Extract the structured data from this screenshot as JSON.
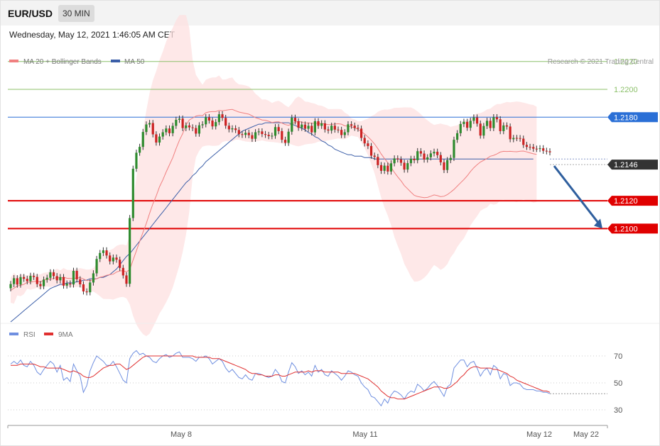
{
  "header": {
    "symbol": "EUR/USD",
    "timeframe": "30 MIN",
    "datetime": "Wednesday, May 12, 2021 1:46:05 AM CET"
  },
  "legend": {
    "ma20": "MA 20 + Bollinger Bands",
    "ma50": "MA 50",
    "copyright": "Research © 2021 Trading Central"
  },
  "rsi_legend": {
    "rsi": "RSI",
    "ma": "9MA"
  },
  "colors": {
    "up": "#2e8b2e",
    "down": "#cc2222",
    "ma20": "#f08080",
    "ma50": "#3b5ea8",
    "band": "#fde0e0",
    "resistance": "#2a6fd6",
    "support": "#e00000",
    "target_arrow": "#2f5f9e",
    "rsi": "#6f8fe0",
    "rsi_ma": "#e03030",
    "green_level": "#8cc06a"
  },
  "chart_data": [
    {
      "type": "line",
      "title": "",
      "x_ticks": [
        "May 8",
        "May 11",
        "May 12",
        "May 22"
      ],
      "y_ticks": [
        "1.2220",
        "1.2200",
        "1.2180",
        "1.2146",
        "1.2120",
        "1.2100"
      ],
      "ylim": [
        1.2032,
        1.2228
      ],
      "levels": [
        {
          "value": 1.222,
          "label": "1.2220",
          "kind": "green"
        },
        {
          "value": 1.22,
          "label": "1.2200",
          "kind": "green"
        },
        {
          "value": 1.218,
          "label": "1.2180",
          "kind": "resistance"
        },
        {
          "value": 1.2146,
          "label": "1.2146",
          "kind": "last"
        },
        {
          "value": 1.212,
          "label": "1.2120",
          "kind": "support"
        },
        {
          "value": 1.21,
          "label": "1.2100",
          "kind": "support"
        }
      ],
      "close": [
        1.20602,
        1.20644,
        1.20598,
        1.20652,
        1.2064,
        1.20622,
        1.20661,
        1.20653,
        1.20602,
        1.20587,
        1.20634,
        1.20647,
        1.20686,
        1.20659,
        1.20629,
        1.20652,
        1.20591,
        1.20606,
        1.20599,
        1.20697,
        1.20636,
        1.206,
        1.20549,
        1.20543,
        1.20613,
        1.20679,
        1.20782,
        1.20825,
        1.20844,
        1.20807,
        1.20765,
        1.20792,
        1.20777,
        1.20718,
        1.20664,
        1.20604,
        1.21076,
        1.2143,
        1.21545,
        1.21587,
        1.21694,
        1.21748,
        1.21758,
        1.21677,
        1.21618,
        1.21661,
        1.21692,
        1.21719,
        1.21685,
        1.21738,
        1.21781,
        1.2179,
        1.21722,
        1.21741,
        1.21727,
        1.21722,
        1.21682,
        1.21742,
        1.21749,
        1.218,
        1.21776,
        1.21734,
        1.21765,
        1.21821,
        1.21795,
        1.21739,
        1.21713,
        1.2172,
        1.21708,
        1.21678,
        1.21673,
        1.21688,
        1.21671,
        1.21645,
        1.21692,
        1.21698,
        1.21679,
        1.21673,
        1.21664,
        1.21667,
        1.21729,
        1.217,
        1.21638,
        1.21616,
        1.21696,
        1.21796,
        1.2177,
        1.21724,
        1.21747,
        1.21717,
        1.21738,
        1.21691,
        1.21771,
        1.21738,
        1.21756,
        1.21712,
        1.21704,
        1.21739,
        1.21711,
        1.21709,
        1.21672,
        1.21692,
        1.21749,
        1.21739,
        1.21724,
        1.21718,
        1.21651,
        1.21612,
        1.21593,
        1.21524,
        1.21515,
        1.21456,
        1.21415,
        1.21452,
        1.2141,
        1.21469,
        1.21504,
        1.21497,
        1.21473,
        1.21424,
        1.2147,
        1.21501,
        1.21491,
        1.21556,
        1.21539,
        1.21496,
        1.21512,
        1.2154,
        1.21552,
        1.21528,
        1.21476,
        1.21421,
        1.21492,
        1.21508,
        1.21638,
        1.21685,
        1.21751,
        1.21767,
        1.21724,
        1.21774,
        1.21798,
        1.21754,
        1.21668,
        1.21737,
        1.21774,
        1.21722,
        1.218,
        1.21785,
        1.217,
        1.21741,
        1.21733,
        1.21642,
        1.21651,
        1.2165,
        1.21646,
        1.21601,
        1.21587,
        1.21586,
        1.21574,
        1.21572,
        1.21577,
        1.21559,
        1.21555,
        1.21548
      ],
      "ma20": [
        1.20557,
        1.20572,
        1.20588,
        1.20593,
        1.206,
        1.20615,
        1.20616,
        1.2062,
        1.20624,
        1.20616,
        1.20632,
        1.20635,
        1.20638,
        1.20642,
        1.2065,
        1.20645,
        1.20651,
        1.20644,
        1.20642,
        1.20642,
        1.20646,
        1.20648,
        1.20639,
        1.20627,
        1.20628,
        1.20632,
        1.20641,
        1.20651,
        1.20656,
        1.20665,
        1.2067,
        1.20673,
        1.20688,
        1.20696,
        1.20698,
        1.20689,
        1.20706,
        1.20774,
        1.2084,
        1.20908,
        1.20974,
        1.21037,
        1.2111,
        1.21178,
        1.21235,
        1.213,
        1.2135,
        1.21407,
        1.21458,
        1.2151,
        1.21574,
        1.21634,
        1.21682,
        1.21744,
        1.2178,
        1.21794,
        1.21808,
        1.21813,
        1.21811,
        1.21832,
        1.21838,
        1.2184,
        1.2184,
        1.21849,
        1.21846,
        1.2185,
        1.21854,
        1.21856,
        1.21846,
        1.21837,
        1.21832,
        1.21827,
        1.21822,
        1.2181,
        1.21797,
        1.21789,
        1.2178,
        1.21778,
        1.21771,
        1.21762,
        1.21766,
        1.21767,
        1.21758,
        1.21747,
        1.21742,
        1.21751,
        1.21764,
        1.2177,
        1.21765,
        1.21758,
        1.21759,
        1.21756,
        1.21756,
        1.21755,
        1.21755,
        1.21751,
        1.21746,
        1.21748,
        1.21751,
        1.21753,
        1.2175,
        1.21738,
        1.21736,
        1.2173,
        1.21723,
        1.21714,
        1.21695,
        1.2168,
        1.21659,
        1.21635,
        1.21608,
        1.21574,
        1.21536,
        1.21503,
        1.21474,
        1.21441,
        1.21404,
        1.21372,
        1.21343,
        1.21309,
        1.21286,
        1.21262,
        1.21239,
        1.21231,
        1.21226,
        1.21222,
        1.21224,
        1.21233,
        1.21242,
        1.21237,
        1.21229,
        1.21233,
        1.21244,
        1.21262,
        1.21281,
        1.21305,
        1.21329,
        1.21352,
        1.21379,
        1.2141,
        1.21437,
        1.21459,
        1.21478,
        1.21491,
        1.21504,
        1.2152,
        1.21526,
        1.21536,
        1.2155,
        1.21555,
        1.21554,
        1.21555,
        1.21553,
        1.21552,
        1.21556,
        1.21557,
        1.21551,
        1.21544,
        1.21537,
        1.21533
      ],
      "ma50": [
        1.2033,
        1.2035,
        1.2037,
        1.2039,
        1.2041,
        1.2043,
        1.2045,
        1.2047,
        1.2049,
        1.2051,
        1.2053,
        1.2055,
        1.2057,
        1.2058,
        1.2059,
        1.206,
        1.206,
        1.2061,
        1.2061,
        1.2061,
        1.2062,
        1.2062,
        1.2063,
        1.2063,
        1.2064,
        1.2064,
        1.2064,
        1.2065,
        1.2065,
        1.2066,
        1.2067,
        1.2069,
        1.2071,
        1.2074,
        1.2077,
        1.208,
        1.2082,
        1.2085,
        1.2088,
        1.2091,
        1.2094,
        1.2097,
        1.21,
        1.2103,
        1.2106,
        1.2109,
        1.2112,
        1.2115,
        1.2118,
        1.2121,
        1.2124,
        1.2127,
        1.213,
        1.2133,
        1.2135,
        1.2138,
        1.214,
        1.2143,
        1.2145,
        1.2148,
        1.215,
        1.2152,
        1.2154,
        1.2156,
        1.2158,
        1.216,
        1.2162,
        1.2164,
        1.2166,
        1.2168,
        1.217,
        1.2171,
        1.2172,
        1.2173,
        1.2174,
        1.2175,
        1.2175,
        1.2176,
        1.2176,
        1.2176,
        1.2176,
        1.2176,
        1.2176,
        1.2176,
        1.2176,
        1.2175,
        1.2174,
        1.2173,
        1.2172,
        1.2171,
        1.2169,
        1.2168,
        1.2166,
        1.2165,
        1.2163,
        1.2162,
        1.216,
        1.2159,
        1.2157,
        1.2156,
        1.2155,
        1.2154,
        1.2153,
        1.2153,
        1.2152,
        1.2152,
        1.2152,
        1.2151,
        1.2151,
        1.2151,
        1.215,
        1.215,
        1.215,
        1.215,
        1.215,
        1.215,
        1.215,
        1.215,
        1.215,
        1.215,
        1.215,
        1.215,
        1.215,
        1.215,
        1.215,
        1.215,
        1.215,
        1.215,
        1.215,
        1.215,
        1.215,
        1.215,
        1.215,
        1.215,
        1.215,
        1.215,
        1.215,
        1.215,
        1.215,
        1.215,
        1.215,
        1.215,
        1.215,
        1.215,
        1.215,
        1.215,
        1.215,
        1.215,
        1.215,
        1.215,
        1.215,
        1.215,
        1.215,
        1.215,
        1.215,
        1.215,
        1.215,
        1.215,
        1.215
      ],
      "target": {
        "from": 1.2146,
        "to": 1.21
      }
    },
    {
      "type": "line",
      "title": "",
      "y_ticks": [
        "70",
        "50",
        "30"
      ],
      "ylim": [
        20,
        80
      ],
      "rsi": [
        64,
        66,
        64,
        67,
        63,
        62,
        66,
        63,
        58,
        56,
        60,
        63,
        66,
        64,
        58,
        63,
        52,
        54,
        51,
        64,
        59,
        55,
        43,
        48,
        59,
        65,
        70,
        68,
        66,
        63,
        63,
        66,
        62,
        57,
        52,
        50,
        68,
        72,
        74,
        71,
        72,
        70,
        69,
        66,
        65,
        68,
        70,
        71,
        69,
        70,
        72,
        73,
        69,
        69,
        69,
        68,
        66,
        69,
        69,
        70,
        68,
        64,
        66,
        68,
        66,
        61,
        58,
        60,
        57,
        54,
        53,
        56,
        53,
        52,
        57,
        57,
        56,
        55,
        54,
        55,
        60,
        57,
        51,
        50,
        58,
        65,
        62,
        57,
        59,
        56,
        58,
        55,
        63,
        58,
        60,
        56,
        55,
        59,
        57,
        55,
        52,
        55,
        59,
        58,
        56,
        55,
        50,
        47,
        45,
        40,
        39,
        36,
        33,
        38,
        35,
        41,
        44,
        43,
        41,
        38,
        42,
        44,
        43,
        49,
        47,
        44,
        46,
        49,
        51,
        48,
        44,
        40,
        47,
        49,
        61,
        64,
        67,
        67,
        62,
        65,
        66,
        61,
        55,
        59,
        61,
        56,
        63,
        61,
        53,
        57,
        56,
        48,
        50,
        50,
        49,
        46,
        45,
        45,
        45,
        44,
        44,
        43,
        43,
        42
      ],
      "rsi_ma": [
        63,
        63,
        63,
        64,
        64,
        64,
        64,
        64,
        63,
        62,
        62,
        61,
        61,
        61,
        61,
        61,
        60,
        59,
        58,
        59,
        58,
        57,
        55,
        54,
        54,
        55,
        57,
        59,
        61,
        62,
        63,
        63,
        64,
        64,
        62,
        60,
        61,
        63,
        65,
        67,
        69,
        70,
        70,
        70,
        70,
        70,
        70,
        70,
        70,
        70,
        70,
        70,
        70,
        70,
        70,
        70,
        69,
        69,
        69,
        69,
        69,
        68,
        68,
        68,
        67,
        66,
        65,
        64,
        63,
        62,
        61,
        60,
        58,
        57,
        57,
        56,
        56,
        55,
        55,
        55,
        56,
        56,
        55,
        55,
        56,
        57,
        58,
        58,
        58,
        58,
        59,
        58,
        59,
        59,
        59,
        58,
        58,
        58,
        58,
        58,
        57,
        57,
        57,
        57,
        57,
        56,
        55,
        54,
        53,
        51,
        49,
        47,
        44,
        42,
        40,
        39,
        39,
        38,
        38,
        38,
        39,
        40,
        41,
        42,
        43,
        44,
        45,
        46,
        47,
        47,
        47,
        46,
        46,
        47,
        49,
        51,
        54,
        56,
        59,
        61,
        62,
        62,
        61,
        61,
        61,
        61,
        60,
        60,
        59,
        58,
        57,
        55,
        54,
        52,
        51,
        50,
        49,
        48,
        47,
        46,
        45,
        44,
        44,
        43
      ],
      "last_value": 42
    }
  ]
}
